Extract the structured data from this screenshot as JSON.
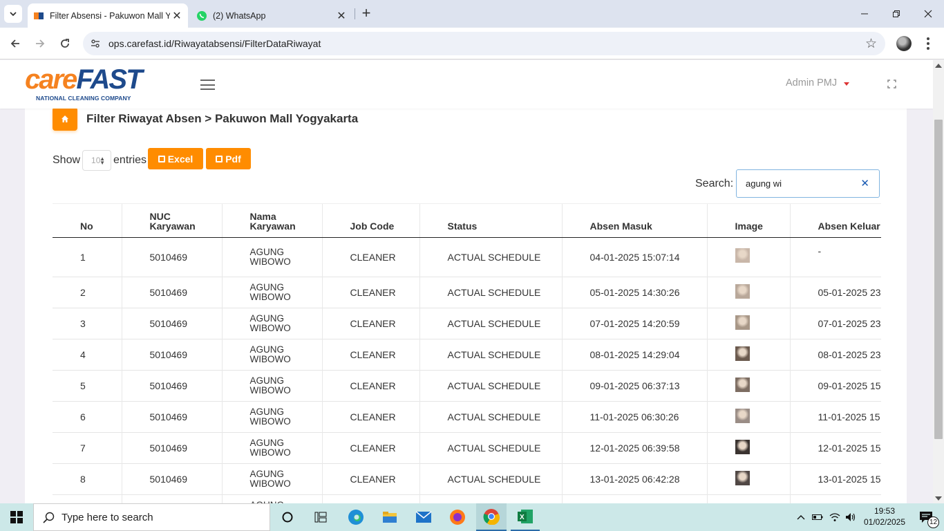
{
  "browser": {
    "tabs": [
      {
        "title": "Filter Absensi - Pakuwon Mall Y",
        "close": "✕"
      },
      {
        "title": "(2) WhatsApp",
        "close": "✕"
      }
    ],
    "new_tab": "+",
    "url": "ops.carefast.id/Riwayatabsensi/FilterDataRiwayat"
  },
  "header": {
    "logo_care": "care",
    "logo_fast": "FAST",
    "logo_tagline": "NATIONAL CLEANING COMPANY",
    "user": "Admin PMJ"
  },
  "breadcrumb": "Filter Riwayat Absen > Pakuwon Mall Yogyakarta",
  "controls": {
    "show_label": "Show",
    "entries_label": "entries",
    "page_length": "10",
    "excel_label": "Excel",
    "pdf_label": "Pdf",
    "search_label": "Search:",
    "search_value": "agung wi",
    "clear": "✕"
  },
  "table": {
    "headers": {
      "no": "No",
      "nuc_1": "NUC",
      "nuc_2": "Karyawan",
      "nama_1": "Nama",
      "nama_2": "Karyawan",
      "job": "Job Code",
      "status": "Status",
      "masuk": "Absen Masuk",
      "image": "Image",
      "keluar": "Absen Keluar"
    },
    "rows": [
      {
        "no": "1",
        "nuc": "5010469",
        "nama1": "AGUNG",
        "nama2": "WIBOWO",
        "job": "CLEANER",
        "status": "ACTUAL SCHEDULE",
        "masuk": "04-01-2025 15:07:14",
        "keluar": "-"
      },
      {
        "no": "2",
        "nuc": "5010469",
        "nama1": "AGUNG",
        "nama2": "WIBOWO",
        "job": "CLEANER",
        "status": "ACTUAL SCHEDULE",
        "masuk": "05-01-2025 14:30:26",
        "keluar": "05-01-2025 23"
      },
      {
        "no": "3",
        "nuc": "5010469",
        "nama1": "AGUNG",
        "nama2": "WIBOWO",
        "job": "CLEANER",
        "status": "ACTUAL SCHEDULE",
        "masuk": "07-01-2025 14:20:59",
        "keluar": "07-01-2025 23"
      },
      {
        "no": "4",
        "nuc": "5010469",
        "nama1": "AGUNG",
        "nama2": "WIBOWO",
        "job": "CLEANER",
        "status": "ACTUAL SCHEDULE",
        "masuk": "08-01-2025 14:29:04",
        "keluar": "08-01-2025 23"
      },
      {
        "no": "5",
        "nuc": "5010469",
        "nama1": "AGUNG",
        "nama2": "WIBOWO",
        "job": "CLEANER",
        "status": "ACTUAL SCHEDULE",
        "masuk": "09-01-2025 06:37:13",
        "keluar": "09-01-2025 15"
      },
      {
        "no": "6",
        "nuc": "5010469",
        "nama1": "AGUNG",
        "nama2": "WIBOWO",
        "job": "CLEANER",
        "status": "ACTUAL SCHEDULE",
        "masuk": "11-01-2025 06:30:26",
        "keluar": "11-01-2025 15"
      },
      {
        "no": "7",
        "nuc": "5010469",
        "nama1": "AGUNG",
        "nama2": "WIBOWO",
        "job": "CLEANER",
        "status": "ACTUAL SCHEDULE",
        "masuk": "12-01-2025 06:39:58",
        "keluar": "12-01-2025 15"
      },
      {
        "no": "8",
        "nuc": "5010469",
        "nama1": "AGUNG",
        "nama2": "WIBOWO",
        "job": "CLEANER",
        "status": "ACTUAL SCHEDULE",
        "masuk": "13-01-2025 06:42:28",
        "keluar": "13-01-2025 15"
      },
      {
        "no": "",
        "nuc": "",
        "nama1": "AGUNG",
        "nama2": "",
        "job": "",
        "status": "",
        "masuk": "",
        "keluar": ""
      }
    ]
  },
  "taskbar": {
    "search_placeholder": "Type here to search",
    "time": "19:53",
    "date": "01/02/2025",
    "notifications": "12"
  },
  "colors": {
    "accent": "#ff8c00",
    "brand_orange": "#f58220",
    "brand_blue": "#1e4a8c",
    "taskbar": "#cce8e8"
  }
}
